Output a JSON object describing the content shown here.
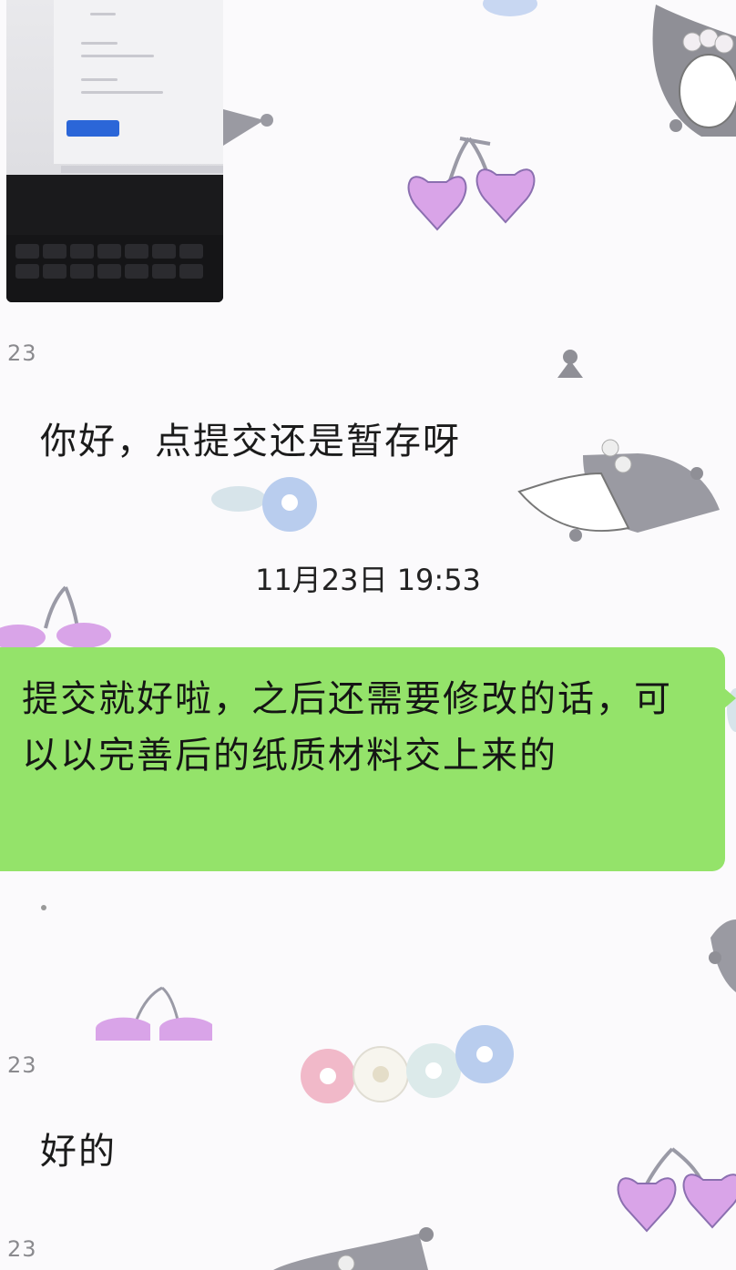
{
  "chat": {
    "messages": [
      {
        "type": "image",
        "sender": "23"
      },
      {
        "type": "text",
        "sender": "23",
        "text": "你好，点提交还是暂存呀"
      },
      {
        "type": "timestamp",
        "text": "11月23日 19:53"
      },
      {
        "type": "text",
        "sender": "self",
        "text": "提交就好啦，之后还需要修改的话，可以以完善后的纸质材料交上来的"
      },
      {
        "type": "text",
        "sender": "23",
        "text": "好的"
      },
      {
        "type": "text",
        "sender": "23",
        "text": ""
      }
    ],
    "sender_labels": [
      "23",
      "23",
      "23"
    ],
    "outgoing_bubble_color": "#94e36a",
    "background_style": "kuromi-cherry-flower-wallpaper"
  }
}
